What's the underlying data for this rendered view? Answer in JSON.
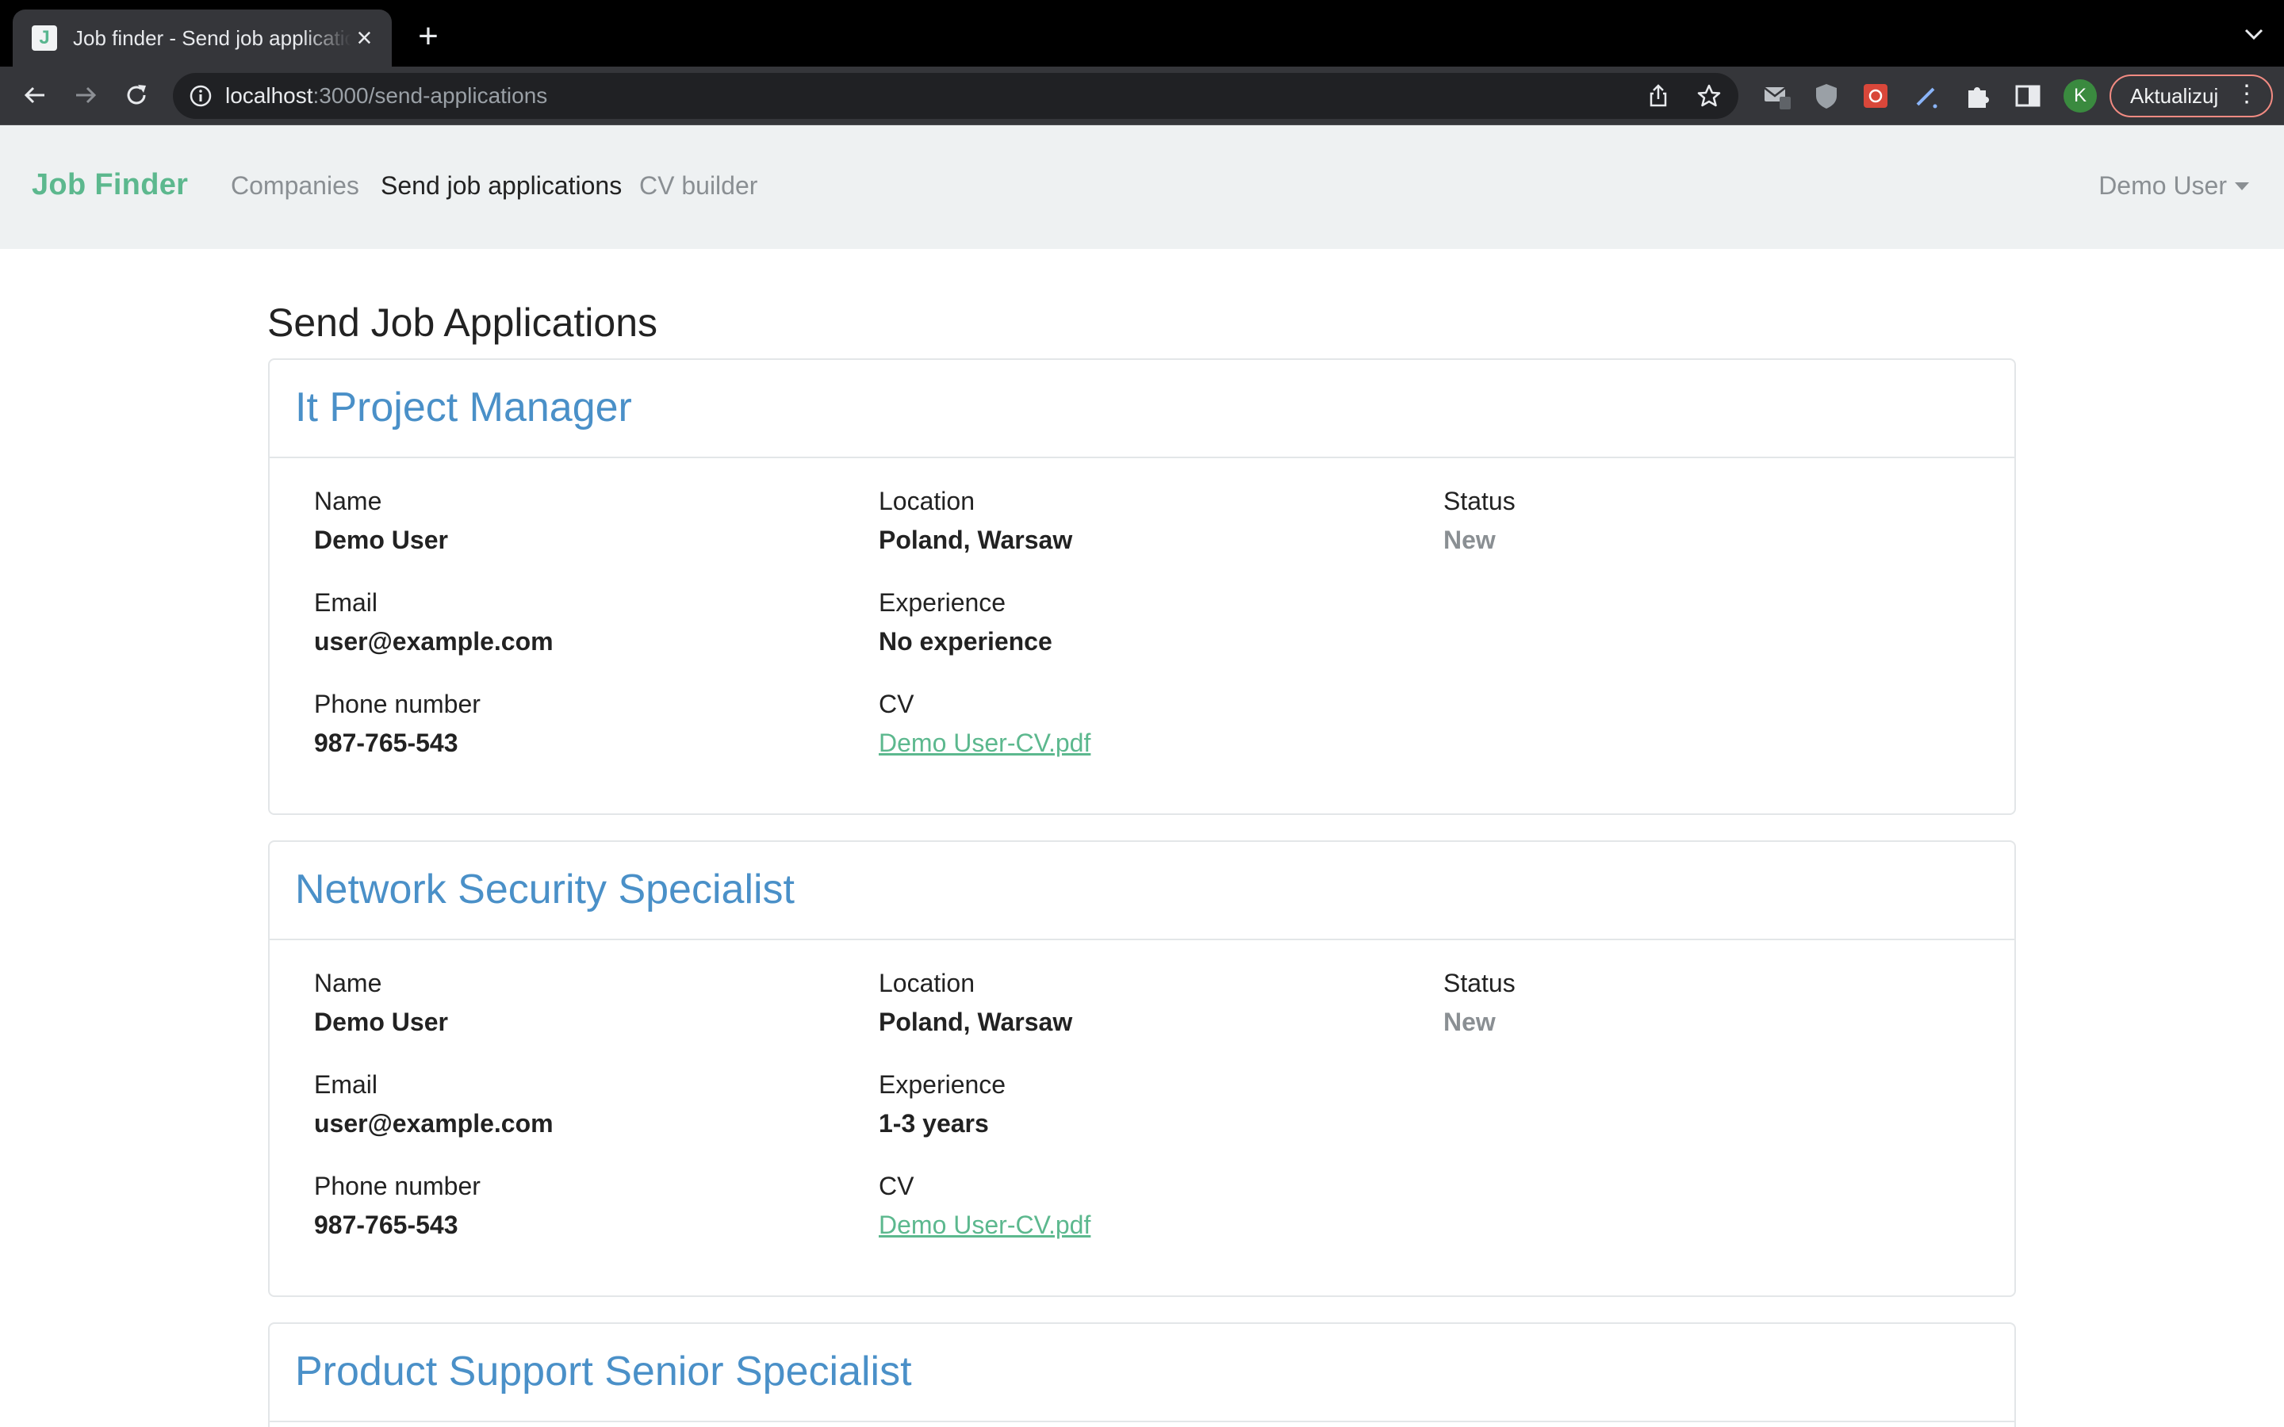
{
  "browser": {
    "tab_title": "Job finder - Send job applications",
    "tab_favicon_letter": "J",
    "url_host": "localhost",
    "url_path": ":3000/send-applications",
    "profile_initial": "K",
    "update_label": "Aktualizuj"
  },
  "navbar": {
    "brand": "Job Finder",
    "links": [
      {
        "label": "Companies",
        "active": false
      },
      {
        "label": "Send job applications",
        "active": true
      },
      {
        "label": "CV builder",
        "active": false
      }
    ],
    "user": "Demo User"
  },
  "page": {
    "title": "Send Job Applications",
    "labels": {
      "name": "Name",
      "email": "Email",
      "phone": "Phone number",
      "location": "Location",
      "experience": "Experience",
      "cv": "CV",
      "status": "Status"
    },
    "applications": [
      {
        "title": "It Project Manager",
        "name": "Demo User",
        "email": "user@example.com",
        "phone": "987-765-543",
        "location": "Poland, Warsaw",
        "experience": "No experience",
        "cv": "Demo User-CV.pdf",
        "status": "New"
      },
      {
        "title": "Network Security Specialist",
        "name": "Demo User",
        "email": "user@example.com",
        "phone": "987-765-543",
        "location": "Poland, Warsaw",
        "experience": "1-3 years",
        "cv": "Demo User-CV.pdf",
        "status": "New"
      },
      {
        "title": "Product Support Senior Specialist"
      }
    ]
  },
  "colors": {
    "brand": "#5cb88e",
    "card_title": "#4a90c8",
    "status": "#8a8f93"
  }
}
